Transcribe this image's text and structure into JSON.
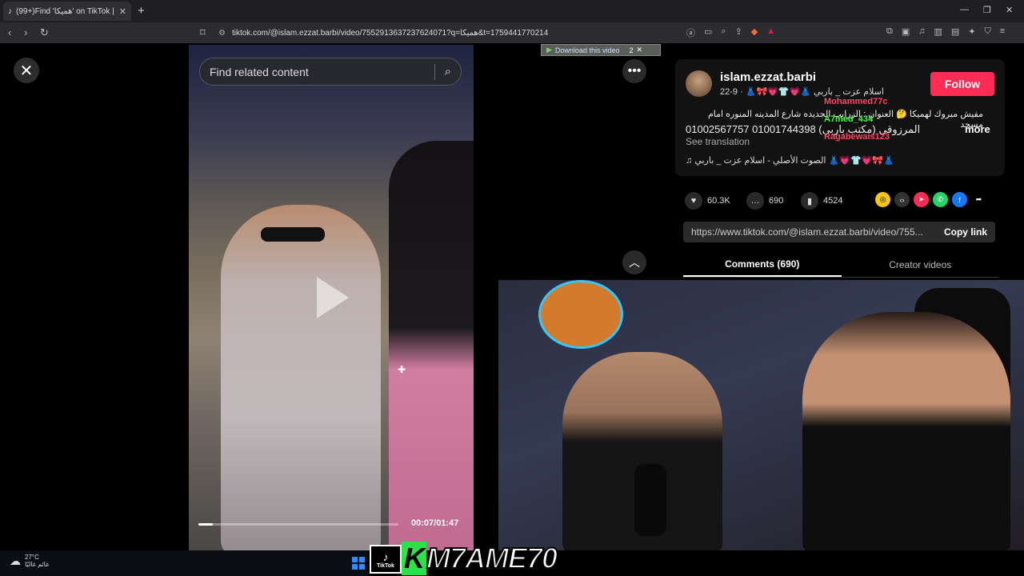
{
  "browser": {
    "tab_title": "(99+)Find 'هميكا' on TikTok | TikTok",
    "url": "tiktok.com/@islam.ezzat.barbi/video/7552913637237624071?q=هميكا&t=1759441770214"
  },
  "player": {
    "search_placeholder": "Find related content",
    "time": "00:07/01:47",
    "progress_fraction": 0.07,
    "download_label": "Download this video",
    "download_count": "2"
  },
  "post": {
    "username": "islam.ezzat.barbi",
    "nickname": "اسلام عزت _ باربي 👗💗👕💗🎀👗 · 9-22",
    "follow_label": "Follow",
    "desc_line1": "مفيش مبروك لهميكا 🤔 العنوان : الزرايب الجديده شارع المدينه المنوره امام مسجد",
    "desc_line2": "01002567757 01001744398 (مكتب باربي) المرزوقي",
    "more_label": "more",
    "see_translation": "See translation",
    "music": "الصوت الأصلي - اسلام عزت _ باربي 👗💗👕💗🎀👗",
    "likes": "60.3K",
    "comments": "690",
    "saves": "4524",
    "link": "https://www.tiktok.com/@islam.ezzat.barbi/video/755...",
    "copy_label": "Copy link",
    "tabs": [
      "Comments (690)",
      "Creator videos"
    ]
  },
  "chat_overlay": [
    {
      "user": "Mohammed77c",
      "color": "#ff4466"
    },
    {
      "user": "A7med_434",
      "color": "#3cff3c"
    },
    {
      "user": "Ragabewais123",
      "color": "#ff4466"
    }
  ],
  "taskbar": {
    "temperature": "27°C",
    "weather_text": "غائم غالبًا"
  },
  "watermark": {
    "tiktok_label": "TikTok",
    "brand_k": "K",
    "brand_rest": "M7AME70"
  }
}
